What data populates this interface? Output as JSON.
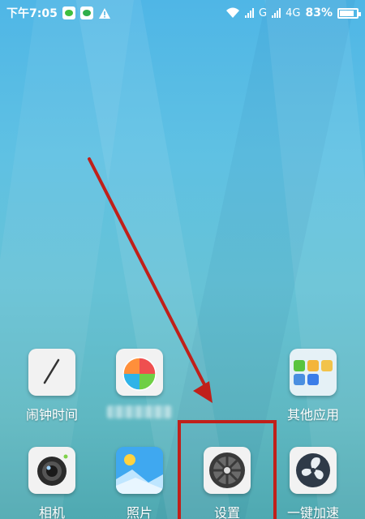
{
  "status_bar": {
    "time": "下午7:05",
    "network_g": "G",
    "network_4g": "4G",
    "battery_percent": "83%",
    "battery_level": 0.83
  },
  "apps": {
    "alarm_clock": {
      "label": "闹钟时间"
    },
    "app_store": {
      "label": ""
    },
    "other_apps_folder": {
      "label": "其他应用"
    },
    "camera": {
      "label": "相机"
    },
    "photos": {
      "label": "照片"
    },
    "settings": {
      "label": "设置"
    },
    "one_key_speedup": {
      "label": "一键加速"
    }
  },
  "annotation": {
    "arrow_color": "#c0201a",
    "box_color": "#c0201a"
  }
}
